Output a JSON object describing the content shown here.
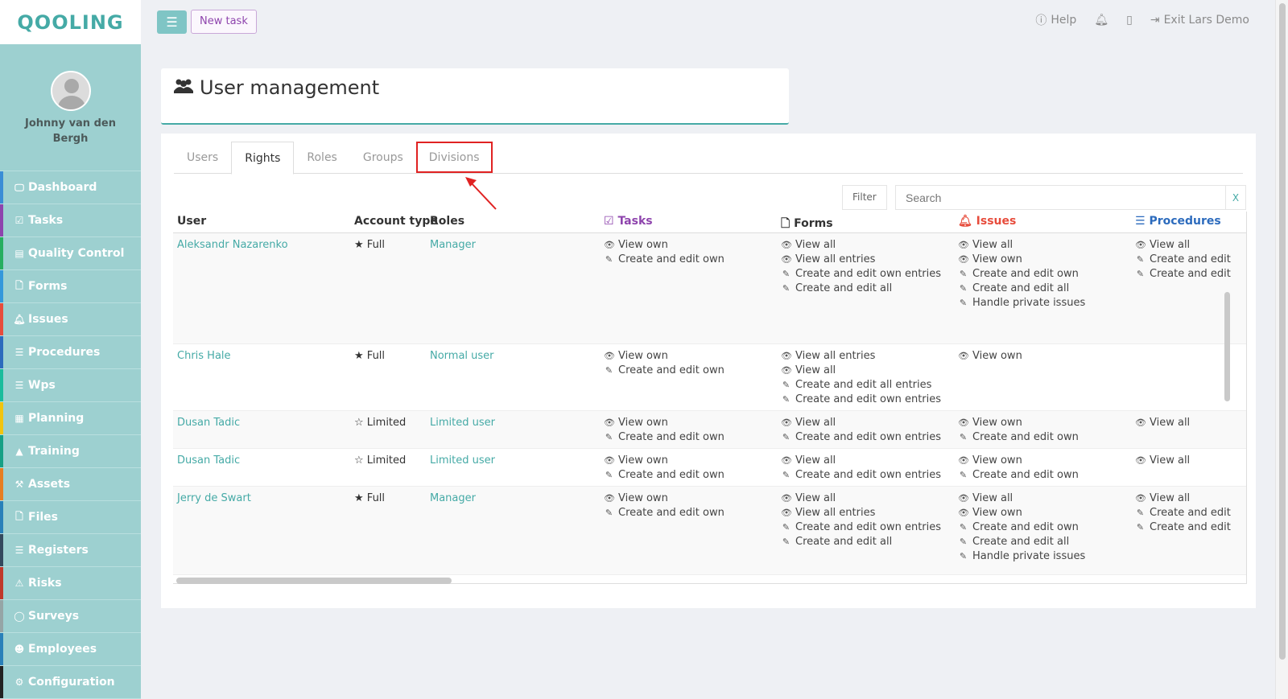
{
  "brand": {
    "logo_text": "QOOLING"
  },
  "topbar": {
    "new_task": "New task",
    "help": "Help",
    "exit": "Exit Lars Demo"
  },
  "sidebar": {
    "user_name": "Johnny van den Bergh",
    "items": [
      {
        "label": "Dashboard",
        "icon": "monitor-icon",
        "color": "#3a8dd6"
      },
      {
        "label": "Tasks",
        "icon": "check-square-icon",
        "color": "#8e44ad"
      },
      {
        "label": "Quality Control",
        "icon": "book-icon",
        "color": "#27ae60"
      },
      {
        "label": "Forms",
        "icon": "file-icon",
        "color": "#3498db"
      },
      {
        "label": "Issues",
        "icon": "bell-icon",
        "color": "#e74c3c"
      },
      {
        "label": "Procedures",
        "icon": "list-icon",
        "color": "#2c6bbd"
      },
      {
        "label": "Wps",
        "icon": "list-icon",
        "color": "#1abc9c"
      },
      {
        "label": "Planning",
        "icon": "calendar-icon",
        "color": "#f1c40f"
      },
      {
        "label": "Training",
        "icon": "graduation-cap-icon",
        "color": "#16a085"
      },
      {
        "label": "Assets",
        "icon": "wrench-icon",
        "color": "#e67e22"
      },
      {
        "label": "Files",
        "icon": "file-icon",
        "color": "#2980b9"
      },
      {
        "label": "Registers",
        "icon": "list-icon",
        "color": "#34495e"
      },
      {
        "label": "Risks",
        "icon": "warning-icon",
        "color": "#c0392b"
      },
      {
        "label": "Surveys",
        "icon": "comment-icon",
        "color": "#95a5a6"
      },
      {
        "label": "Employees",
        "icon": "users-icon",
        "color": "#2980b9"
      },
      {
        "label": "Configuration",
        "icon": "gear-icon",
        "color": "#222222"
      }
    ]
  },
  "page": {
    "title": "User management"
  },
  "tabs": [
    "Users",
    "Rights",
    "Roles",
    "Groups",
    "Divisions"
  ],
  "active_tab": "Rights",
  "highlighted_tab": "Divisions",
  "toolbar": {
    "filter": "Filter",
    "search_placeholder": "Search",
    "clear": "X"
  },
  "table": {
    "headers": {
      "user": "User",
      "account_type": "Account type",
      "roles": "Roles",
      "tasks": "Tasks",
      "forms": "Forms",
      "issues": "Issues",
      "procedures": "Procedures"
    },
    "rows": [
      {
        "user": "Aleksandr Nazarenko",
        "account_type": "Full",
        "account_icon": "star-icon",
        "role": "Manager",
        "tasks": [
          [
            "eye",
            "View own"
          ],
          [
            "edit",
            "Create and edit own"
          ]
        ],
        "forms": [
          [
            "eye",
            "View all"
          ],
          [
            "eye",
            "View all entries"
          ],
          [
            "edit",
            "Create and edit own entries"
          ],
          [
            "edit",
            "Create and edit all"
          ]
        ],
        "issues": [
          [
            "eye",
            "View all"
          ],
          [
            "eye",
            "View own"
          ],
          [
            "edit",
            "Create and edit own"
          ],
          [
            "edit",
            "Create and edit all"
          ],
          [
            "edit",
            "Handle private issues"
          ]
        ],
        "procedures": [
          [
            "eye",
            "View all"
          ],
          [
            "edit",
            "Create and edit"
          ],
          [
            "edit",
            "Create and edit"
          ]
        ],
        "height": 138
      },
      {
        "user": "Chris Hale",
        "account_type": "Full",
        "account_icon": "star-icon",
        "role": "Normal user",
        "tasks": [
          [
            "eye",
            "View own"
          ],
          [
            "edit",
            "Create and edit own"
          ]
        ],
        "forms": [
          [
            "eye",
            "View all entries"
          ],
          [
            "eye",
            "View all"
          ],
          [
            "edit",
            "Create and edit all entries"
          ],
          [
            "edit",
            "Create and edit own entries"
          ]
        ],
        "issues": [
          [
            "eye",
            "View own"
          ]
        ],
        "procedures": [],
        "height": 83
      },
      {
        "user": "Dusan Tadic",
        "account_type": "Limited",
        "account_icon": "half-star-icon",
        "role": "Limited user",
        "tasks": [
          [
            "eye",
            "View own"
          ],
          [
            "edit",
            "Create and edit own"
          ]
        ],
        "forms": [
          [
            "eye",
            "View all"
          ],
          [
            "edit",
            "Create and edit own entries"
          ]
        ],
        "issues": [
          [
            "eye",
            "View own"
          ],
          [
            "edit",
            "Create and edit own"
          ]
        ],
        "procedures": [
          [
            "eye",
            "View all"
          ]
        ],
        "height": 47
      },
      {
        "user": "Dusan Tadic",
        "account_type": "Limited",
        "account_icon": "half-star-icon",
        "role": "Limited user",
        "tasks": [
          [
            "eye",
            "View own"
          ],
          [
            "edit",
            "Create and edit own"
          ]
        ],
        "forms": [
          [
            "eye",
            "View all"
          ],
          [
            "edit",
            "Create and edit own entries"
          ]
        ],
        "issues": [
          [
            "eye",
            "View own"
          ],
          [
            "edit",
            "Create and edit own"
          ]
        ],
        "procedures": [
          [
            "eye",
            "View all"
          ]
        ],
        "height": 47
      },
      {
        "user": "Jerry de Swart",
        "account_type": "Full",
        "account_icon": "star-icon",
        "role": "Manager",
        "tasks": [
          [
            "eye",
            "View own"
          ],
          [
            "edit",
            "Create and edit own"
          ]
        ],
        "forms": [
          [
            "eye",
            "View all"
          ],
          [
            "eye",
            "View all entries"
          ],
          [
            "edit",
            "Create and edit own entries"
          ],
          [
            "edit",
            "Create and edit all"
          ]
        ],
        "issues": [
          [
            "eye",
            "View all"
          ],
          [
            "eye",
            "View own"
          ],
          [
            "edit",
            "Create and edit own"
          ],
          [
            "edit",
            "Create and edit all"
          ],
          [
            "edit",
            "Handle private issues"
          ]
        ],
        "procedures": [
          [
            "eye",
            "View all"
          ],
          [
            "edit",
            "Create and edit"
          ],
          [
            "edit",
            "Create and edit"
          ]
        ],
        "height": 110
      }
    ]
  }
}
